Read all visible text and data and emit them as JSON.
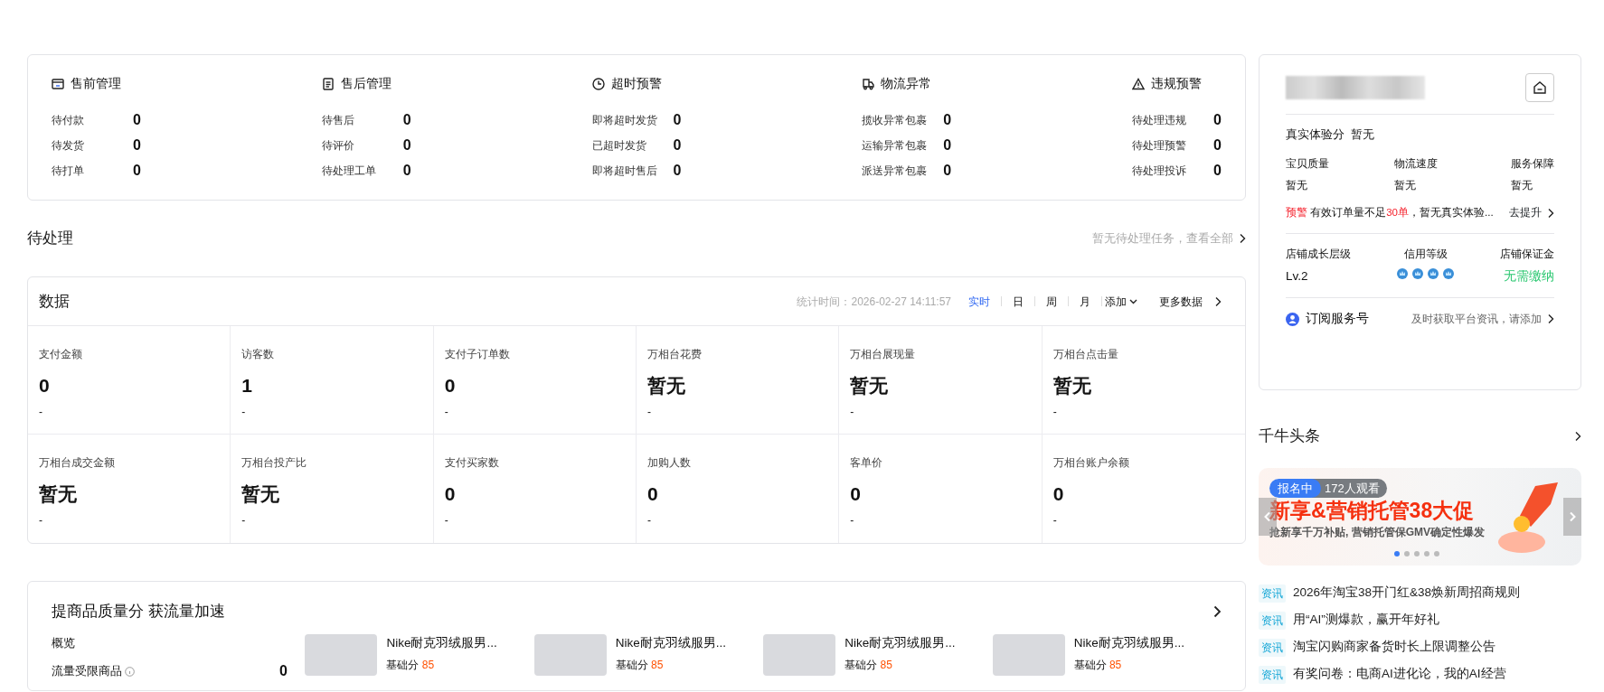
{
  "overview": [
    {
      "title": "售前管理",
      "items": [
        {
          "label": "待付款",
          "value": "0"
        },
        {
          "label": "待发货",
          "value": "0"
        },
        {
          "label": "待打单",
          "value": "0"
        }
      ]
    },
    {
      "title": "售后管理",
      "items": [
        {
          "label": "待售后",
          "value": "0"
        },
        {
          "label": "待评价",
          "value": "0"
        },
        {
          "label": "待处理工单",
          "value": "0"
        }
      ]
    },
    {
      "title": "超时预警",
      "items": [
        {
          "label": "即将超时发货",
          "value": "0"
        },
        {
          "label": "已超时发货",
          "value": "0"
        },
        {
          "label": "即将超时售后",
          "value": "0"
        }
      ]
    },
    {
      "title": "物流异常",
      "items": [
        {
          "label": "揽收异常包裹",
          "value": "0"
        },
        {
          "label": "运输异常包裹",
          "value": "0"
        },
        {
          "label": "派送异常包裹",
          "value": "0"
        }
      ]
    },
    {
      "title": "违规预警",
      "items": [
        {
          "label": "待处理违规",
          "value": "0"
        },
        {
          "label": "待处理预警",
          "value": "0"
        },
        {
          "label": "待处理投诉",
          "value": "0"
        }
      ]
    }
  ],
  "todo": {
    "title": "待处理",
    "link": "暂无待处理任务，查看全部"
  },
  "data": {
    "title": "数据",
    "stat_time": "统计时间：2026-02-27 14:11:57",
    "periods": [
      {
        "label": "实时",
        "selected": true
      },
      {
        "label": "日",
        "selected": false
      },
      {
        "label": "周",
        "selected": false
      },
      {
        "label": "月",
        "selected": false
      }
    ],
    "add": "添加",
    "more": "更多数据",
    "metrics": [
      {
        "label": "支付金额",
        "value": "0",
        "change": "-"
      },
      {
        "label": "访客数",
        "value": "1",
        "change": "-"
      },
      {
        "label": "支付子订单数",
        "value": "0",
        "change": "-"
      },
      {
        "label": "万相台花费",
        "value": "暂无",
        "change": "-"
      },
      {
        "label": "万相台展现量",
        "value": "暂无",
        "change": "-"
      },
      {
        "label": "万相台点击量",
        "value": "暂无",
        "change": "-"
      },
      {
        "label": "万相台成交金额",
        "value": "暂无",
        "change": "-"
      },
      {
        "label": "万相台投产比",
        "value": "暂无",
        "change": "-"
      },
      {
        "label": "支付买家数",
        "value": "0",
        "change": "-"
      },
      {
        "label": "加购人数",
        "value": "0",
        "change": "-"
      },
      {
        "label": "客单价",
        "value": "0",
        "change": "-"
      },
      {
        "label": "万相台账户余额",
        "value": "0",
        "change": "-"
      }
    ]
  },
  "quality": {
    "title": "提商品质量分 获流量加速",
    "overview_label": "概览",
    "restricted_label": "流量受限商品",
    "restricted_value": "0",
    "products": [
      {
        "title": "Nike耐克羽绒服男...",
        "score_label": "基础分",
        "score": "85"
      },
      {
        "title": "Nike耐克羽绒服男...",
        "score_label": "基础分",
        "score": "85"
      },
      {
        "title": "Nike耐克羽绒服男...",
        "score_label": "基础分",
        "score": "85"
      },
      {
        "title": "Nike耐克羽绒服男...",
        "score_label": "基础分",
        "score": "85"
      }
    ]
  },
  "store": {
    "experience_label": "真实体验分",
    "experience_value": "暂无",
    "scores": [
      {
        "label": "宝贝质量",
        "value": "暂无"
      },
      {
        "label": "物流速度",
        "value": "暂无"
      },
      {
        "label": "服务保障",
        "value": "暂无"
      }
    ],
    "warning": [
      {
        "text": "预警",
        "alert": true
      },
      {
        "text": " 有效订单量不足",
        "alert": false
      },
      {
        "text": "30单",
        "alert": true
      },
      {
        "text": "，暂无真实体验...",
        "alert": false
      }
    ],
    "improve": "去提升",
    "levels": [
      {
        "label": "店铺成长层级",
        "kind": "text",
        "value": "Lv.2"
      },
      {
        "label": "信用等级",
        "kind": "crowns",
        "stars": 4
      },
      {
        "label": "店铺保证金",
        "kind": "status",
        "value": "无需缴纳"
      }
    ],
    "subscribe": {
      "label": "订阅服务号",
      "hint": "及时获取平台资讯，请添加"
    }
  },
  "headlines": {
    "title": "千牛头条",
    "banner": {
      "badge": "报名中",
      "viewers": "172人观看",
      "headline": "新享&营销托管38大促",
      "subtitle": "抢新享千万补贴, 营销托管保GMV确定性爆发",
      "dots": [
        {
          "selected": true
        },
        {
          "selected": false
        },
        {
          "selected": false
        },
        {
          "selected": false
        },
        {
          "selected": false
        }
      ]
    },
    "news": [
      {
        "tag": "资讯",
        "text": "2026年淘宝38开门红&38焕新周招商规则"
      },
      {
        "tag": "资讯",
        "text": "用“AI”测爆款，赢开年好礼"
      },
      {
        "tag": "资讯",
        "text": "淘宝闪购商家备货时长上限调整公告"
      },
      {
        "tag": "资讯",
        "text": "有奖问卷：电商AI进化论，我的AI经营"
      }
    ]
  }
}
